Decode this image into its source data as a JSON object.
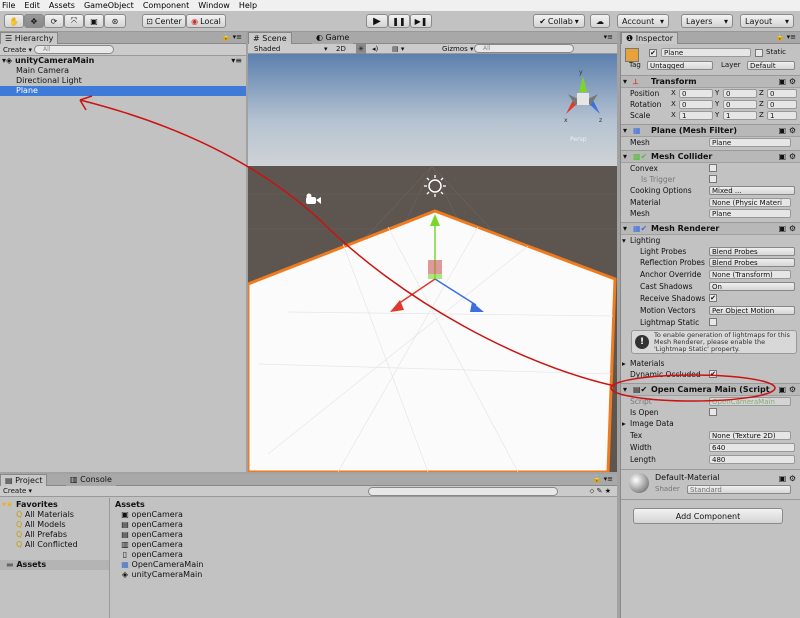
{
  "menu": [
    "File",
    "Edit",
    "Assets",
    "GameObject",
    "Component",
    "Window",
    "Help"
  ],
  "toolbar": {
    "pivot": "Center",
    "space": "Local",
    "collab": "Collab",
    "account": "Account",
    "layers": "Layers",
    "layout": "Layout"
  },
  "hierarchy": {
    "tab": "Hierarchy",
    "create": "Create",
    "search_placeholder": "All",
    "scene_name": "unityCameraMain",
    "items": [
      "Main Camera",
      "Directional Light",
      "Plane"
    ]
  },
  "scene": {
    "tab_scene": "Scene",
    "tab_game": "Game",
    "shading": "Shaded",
    "mode_2d": "2D",
    "gizmos": "Gizmos",
    "search_placeholder": "All",
    "persp": "Persp"
  },
  "inspector": {
    "tab": "Inspector",
    "object_name": "Plane",
    "static_label": "Static",
    "tag_label": "Tag",
    "tag_value": "Untagged",
    "layer_label": "Layer",
    "layer_value": "Default",
    "transform": {
      "title": "Transform",
      "position_label": "Position",
      "position": [
        "0",
        "0",
        "0"
      ],
      "rotation_label": "Rotation",
      "rotation": [
        "0",
        "0",
        "0"
      ],
      "scale_label": "Scale",
      "scale": [
        "1",
        "1",
        "1"
      ]
    },
    "mesh_filter": {
      "title": "Plane (Mesh Filter)",
      "mesh_label": "Mesh",
      "mesh_value": "Plane"
    },
    "mesh_collider": {
      "title": "Mesh Collider",
      "convex": "Convex",
      "is_trigger": "Is Trigger",
      "cooking_label": "Cooking Options",
      "cooking_value": "Mixed ...",
      "material_label": "Material",
      "material_value": "None (Physic Materi",
      "mesh_label": "Mesh",
      "mesh_value": "Plane"
    },
    "mesh_renderer": {
      "title": "Mesh Renderer",
      "lighting": "Lighting",
      "light_probes_label": "Light Probes",
      "light_probes": "Blend Probes",
      "reflection_label": "Reflection Probes",
      "reflection": "Blend Probes",
      "anchor_label": "Anchor Override",
      "anchor": "None (Transform)",
      "cast_label": "Cast Shadows",
      "cast": "On",
      "receive_label": "Receive Shadows",
      "motion_label": "Motion Vectors",
      "motion": "Per Object Motion",
      "lightmap_label": "Lightmap Static",
      "help_text": "To enable generation of lightmaps for this Mesh Renderer, please enable the 'Lightmap Static' property.",
      "materials": "Materials",
      "dynamic_occluded": "Dynamic Occluded"
    },
    "script_component": {
      "title": "Open Camera Main (Script",
      "script_label": "Script",
      "script_value": "OpenCameraMain",
      "is_open": "Is Open",
      "image_data": "Image Data",
      "tex_label": "Tex",
      "tex_value": "None (Texture 2D)",
      "width_label": "Width",
      "width_value": "640",
      "length_label": "Length",
      "length_value": "480"
    },
    "material": {
      "name": "Default-Material",
      "shader_label": "Shader",
      "shader_value": "Standard"
    },
    "add_component": "Add Component"
  },
  "project": {
    "tab_project": "Project",
    "tab_console": "Console",
    "create": "Create",
    "favorites": "Favorites",
    "favorite_items": [
      "All Materials",
      "All Models",
      "All Prefabs",
      "All Conflicted"
    ],
    "assets_root": "Assets",
    "assets_header": "Assets",
    "assets": [
      "openCamera",
      "openCamera",
      "openCamera",
      "openCamera",
      "openCamera",
      "OpenCameraMain",
      "unityCameraMain"
    ]
  },
  "colors": {
    "selection": "#3e7ad8",
    "annotation": "#cc1111",
    "plane_outline": "#f07a1e"
  }
}
